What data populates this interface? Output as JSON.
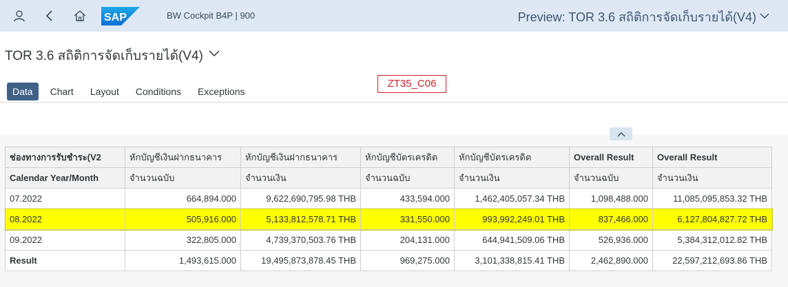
{
  "shell": {
    "title": "BW Cockpit B4P | 900",
    "app_title": "Preview: TOR 3.6 สถิติการจัดเก็บรายได้(V4)",
    "logo_text": "SAP"
  },
  "page": {
    "title": "TOR 3.6 สถิติการจัดเก็บรายได้(V4)",
    "stamp": "ZT35_C06"
  },
  "tabs": [
    "Data",
    "Chart",
    "Layout",
    "Conditions",
    "Exceptions"
  ],
  "table": {
    "header1": [
      "ช่องทางการรับชำระ(V2",
      "หักบัญชีเงินฝากธนาคาร",
      "หักบัญชีเงินฝากธนาคาร",
      "หักบัญชีบัตรเครดิต",
      "หักบัญชีบัตรเครดิต",
      "Overall Result",
      "Overall Result"
    ],
    "header2": [
      "Calendar Year/Month",
      "จำนวนฉบับ",
      "จำนวนเงิน",
      "จำนวนฉบับ",
      "จำนวนเงิน",
      "จำนวนฉบับ",
      "จำนวนเงิน"
    ],
    "rows": [
      [
        "07.2022",
        "664,894.000",
        "9,622,690,795.98 THB",
        "433,594.000",
        "1,462,405,057.34 THB",
        "1,098,488.000",
        "11,085,095,853.32 THB"
      ],
      [
        "08.2022",
        "505,916.000",
        "5,133,812,578.71 THB",
        "331,550.000",
        "993,992,249.01 THB",
        "837,466.000",
        "6,127,804,827.72 THB"
      ],
      [
        "09.2022",
        "322,805.000",
        "4,739,370,503.76 THB",
        "204,131.000",
        "644,941,509.06 THB",
        "526,936.000",
        "5,384,312,012.82 THB"
      ],
      [
        "Result",
        "1,493,615.000",
        "19,495,873,878.45 THB",
        "969,275.000",
        "3,101,338,815.41 THB",
        "2,462,890.000",
        "22,597,212,693.86 THB"
      ]
    ]
  },
  "colors": {
    "shell_bg": "#dde8f4",
    "tab_active": "#3f6185",
    "highlight": "#ffff00",
    "stamp": "#d0202a"
  }
}
